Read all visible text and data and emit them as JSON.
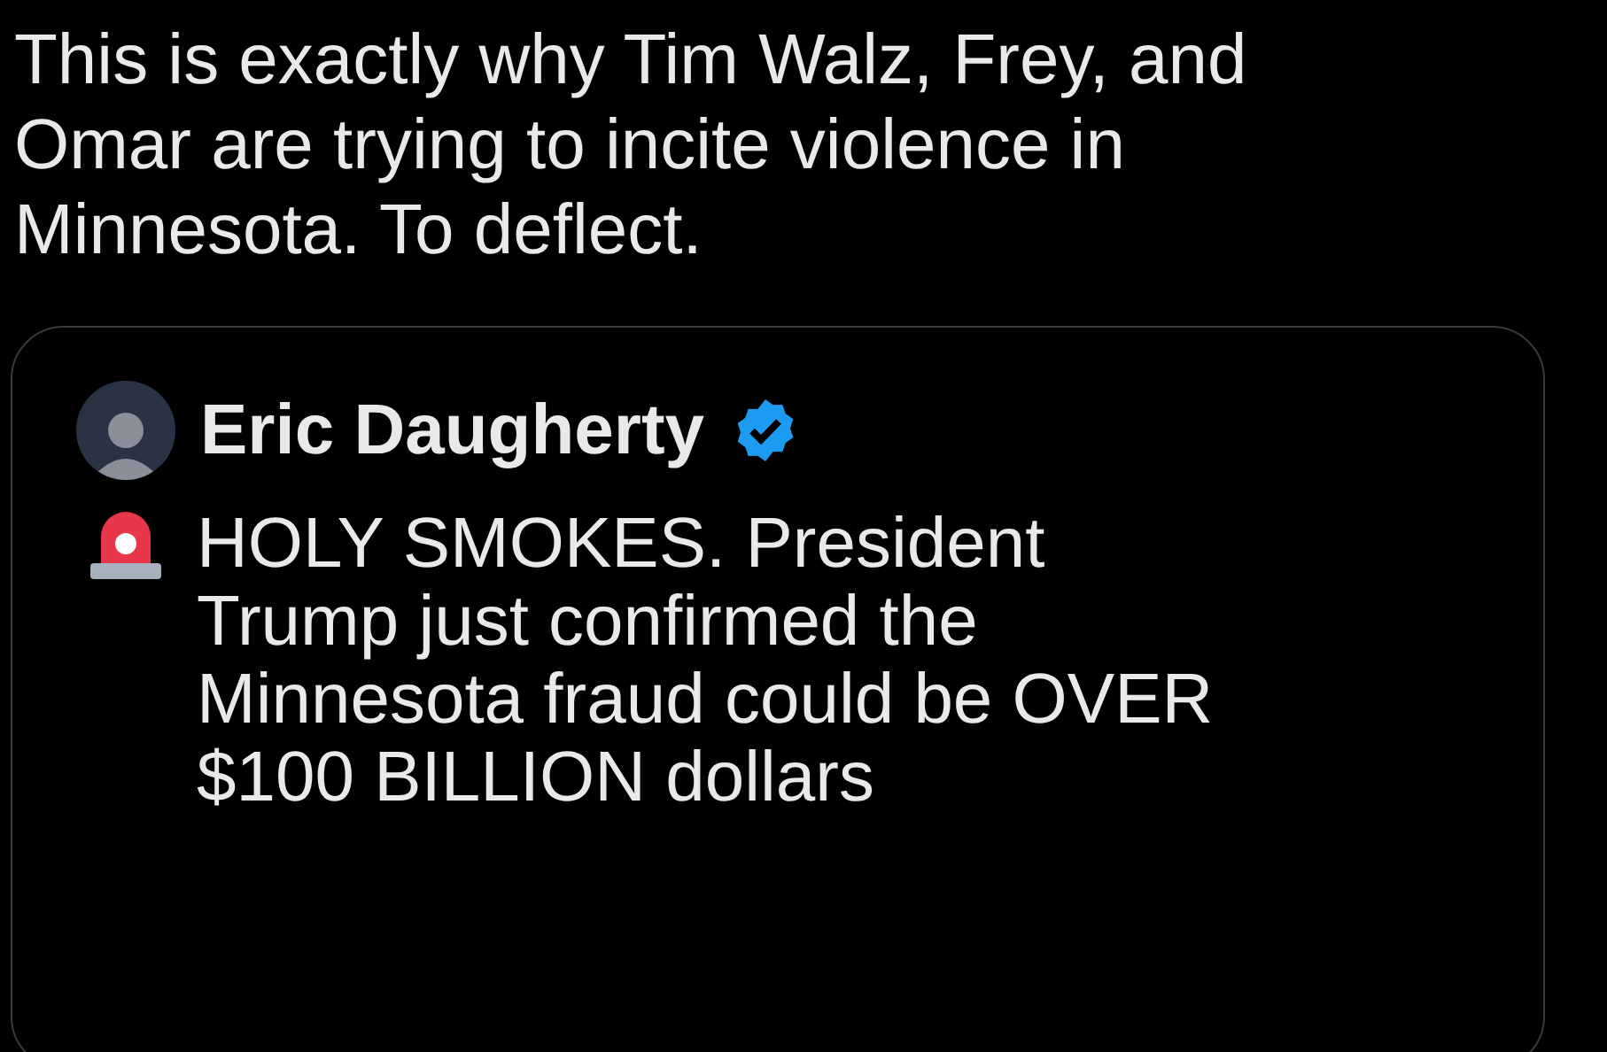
{
  "post": {
    "text": "This is exactly why Tim Walz, Frey, and Omar are trying to incite violence in Minnesota. To deflect."
  },
  "quoted_post": {
    "author": {
      "name": "Eric Daugherty",
      "verified": true
    },
    "text": "HOLY SMOKES. President Trump just confirmed the Minnesota fraud could be OVER $100 BILLION dollars"
  }
}
